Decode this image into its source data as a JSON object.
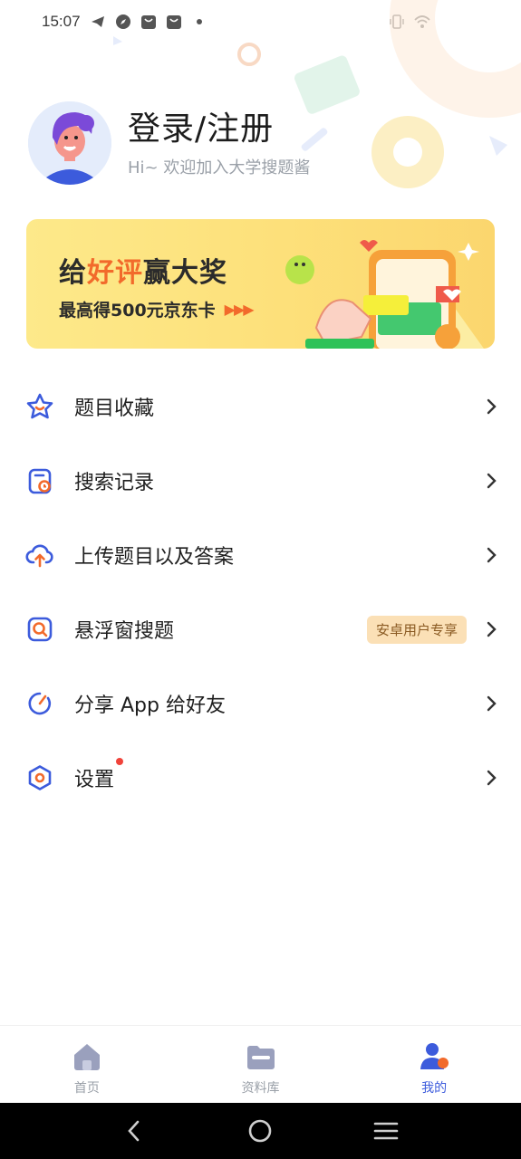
{
  "status_bar": {
    "time": "15:07"
  },
  "profile": {
    "login_title": "登录/注册",
    "welcome": "Hi~ 欢迎加入大学搜题酱"
  },
  "banner": {
    "title_part1": "给",
    "title_highlight": "好评",
    "title_part2": "赢大奖",
    "subtitle": "最高得500元京东卡",
    "arrows": "▶▶▶",
    "accent_color": "#f26a2b"
  },
  "menu": {
    "items": [
      {
        "label": "题目收藏",
        "icon": "star-icon"
      },
      {
        "label": "搜索记录",
        "icon": "history-icon"
      },
      {
        "label": "上传题目以及答案",
        "icon": "upload-cloud-icon"
      },
      {
        "label": "悬浮窗搜题",
        "icon": "floating-search-icon",
        "tag": "安卓用户专享"
      },
      {
        "label": "分享 App 给好友",
        "icon": "share-icon"
      },
      {
        "label": "设置",
        "icon": "settings-icon",
        "badge_dot": true
      }
    ]
  },
  "bottom_nav": {
    "items": [
      {
        "label": "首页",
        "icon": "home-icon"
      },
      {
        "label": "资料库",
        "icon": "folder-icon"
      },
      {
        "label": "我的",
        "icon": "profile-icon",
        "active": true
      }
    ],
    "active_color": "#3c5bdc",
    "inactive_color": "#9aa0a8"
  },
  "theme": {
    "accent_blue": "#3c5bdc",
    "accent_orange": "#f26a2b"
  }
}
